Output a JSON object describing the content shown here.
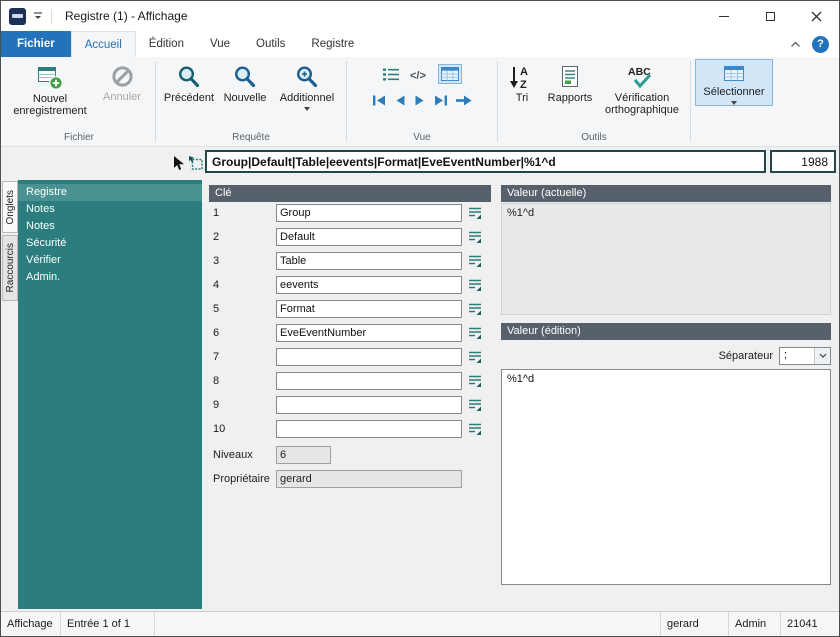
{
  "window": {
    "title": "Registre (1) - Affichage"
  },
  "ribbon": {
    "file_tab": "Fichier",
    "tabs": [
      "Accueil",
      "Édition",
      "Vue",
      "Outils",
      "Registre"
    ],
    "help": "?",
    "groups": {
      "fichier": {
        "label": "Fichier",
        "new_record": "Nouvel enregistrement",
        "cancel": "Annuler"
      },
      "requete": {
        "label": "Requête",
        "previous": "Précédent",
        "new": "Nouvelle",
        "additional": "Additionnel"
      },
      "vue": {
        "label": "Vue"
      },
      "outils": {
        "label": "Outils",
        "sort": "Tri",
        "reports": "Rapports",
        "spellcheck": "Vérification orthographique"
      },
      "select": "Sélectionner"
    }
  },
  "formula_bar": {
    "expression": "Group|Default|Table|eevents|Format|EveEventNumber|%1^d",
    "record_number": "1988"
  },
  "sidebar": {
    "vertical_tabs": [
      "Onglets",
      "Raccourcis"
    ],
    "items": [
      {
        "label": "Registre",
        "selected": true
      },
      {
        "label": "Notes",
        "selected": false
      },
      {
        "label": "Notes",
        "selected": false
      },
      {
        "label": "Sécurité",
        "selected": false
      },
      {
        "label": "Vérifier",
        "selected": false
      },
      {
        "label": "Admin.",
        "selected": false
      }
    ]
  },
  "key_panel": {
    "header": "Clé",
    "rows": [
      {
        "num": "1",
        "value": "Group"
      },
      {
        "num": "2",
        "value": "Default"
      },
      {
        "num": "3",
        "value": "Table"
      },
      {
        "num": "4",
        "value": "eevents"
      },
      {
        "num": "5",
        "value": "Format"
      },
      {
        "num": "6",
        "value": "EveEventNumber"
      },
      {
        "num": "7",
        "value": ""
      },
      {
        "num": "8",
        "value": ""
      },
      {
        "num": "9",
        "value": ""
      },
      {
        "num": "10",
        "value": ""
      }
    ],
    "levels_label": "Niveaux",
    "levels_value": "6",
    "owner_label": "Propriétaire",
    "owner_value": "gerard"
  },
  "value_panel": {
    "current_header": "Valeur (actuelle)",
    "current_value": "%1^d",
    "edit_header": "Valeur (édition)",
    "separator_label": "Séparateur",
    "separator_value": ";",
    "edit_value": "%1^d"
  },
  "status_bar": {
    "view": "Affichage",
    "record_position": "Entrée 1 of 1",
    "user": "gerard",
    "group": "Admin",
    "number": "21041"
  }
}
